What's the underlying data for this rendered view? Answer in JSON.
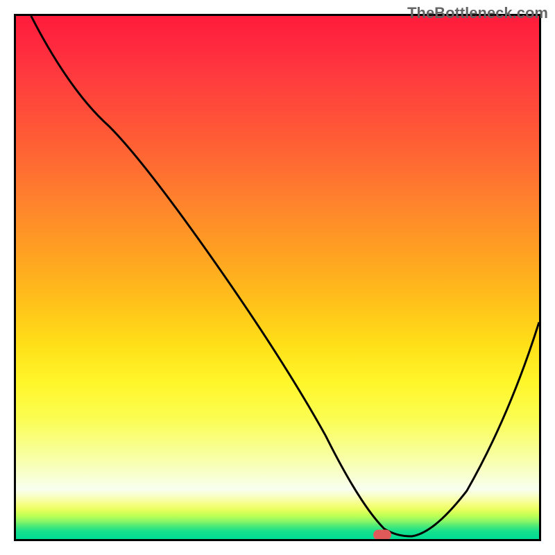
{
  "watermark": "TheBottleneck.com",
  "chart_data": {
    "type": "line",
    "title": "",
    "xlabel": "",
    "ylabel": "",
    "xlim": [
      0,
      100
    ],
    "ylim": [
      0,
      100
    ],
    "background_gradient": {
      "direction": "vertical",
      "stops": [
        {
          "pos": 0,
          "color": "#ff1c3c"
        },
        {
          "pos": 20,
          "color": "#ff5238"
        },
        {
          "pos": 45,
          "color": "#ffa022"
        },
        {
          "pos": 70,
          "color": "#fff62a"
        },
        {
          "pos": 90,
          "color": "#f8fff0"
        },
        {
          "pos": 100,
          "color": "#00dc96"
        }
      ]
    },
    "series": [
      {
        "name": "bottleneck-curve",
        "x": [
          3,
          10,
          18,
          25,
          32,
          40,
          48,
          55,
          60,
          64,
          68,
          72,
          75,
          80,
          86,
          92,
          100
        ],
        "y": [
          100,
          90,
          79,
          70,
          60,
          49,
          38,
          27,
          17,
          9,
          4,
          1,
          0,
          1,
          9,
          22,
          42
        ]
      }
    ],
    "marker": {
      "x": 70,
      "y": 0.8,
      "color": "#e05a5a"
    },
    "grid": false,
    "legend": false
  }
}
